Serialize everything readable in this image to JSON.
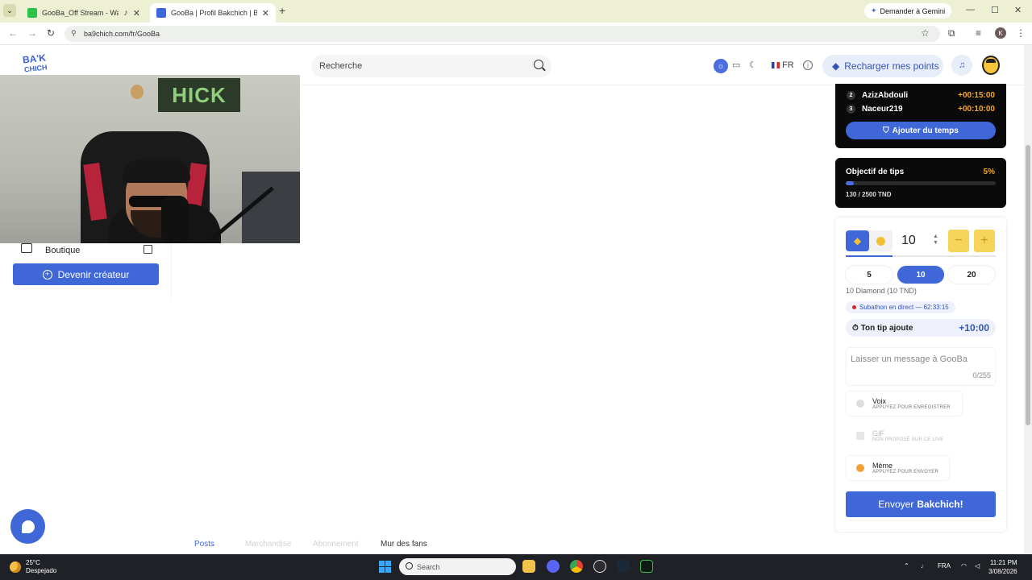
{
  "browser": {
    "tabs": [
      {
        "title": "GooBa_Off Stream - Watch",
        "active": false
      },
      {
        "title": "GooBa | Profil Bakchich | Bakch",
        "active": true
      }
    ],
    "gemini_label": "Demander à Gemini",
    "url": "ba9chich.com/fr/GooBa",
    "profile_initial": "K"
  },
  "header": {
    "logo_line1": "BA'K",
    "logo_line2": "CHICH",
    "search_placeholder": "Recherche",
    "language": "FR",
    "recharge_label": "Recharger mes points"
  },
  "sidebar": {
    "shop_label": "Boutique",
    "become_creator_label": "Devenir créateur"
  },
  "leaderboard": {
    "rows": [
      {
        "rank": "2",
        "name": "AzizAbdouli",
        "time": "+00:15:00"
      },
      {
        "rank": "3",
        "name": "Naceur219",
        "time": "+00:10:00"
      }
    ],
    "add_time_label": "Ajouter du temps"
  },
  "tip_goal": {
    "title": "Objectif de tips",
    "percent": "5%",
    "progress_fraction": 0.052,
    "amount": "130 / 2500 TND"
  },
  "tip_form": {
    "amount": "10",
    "presets": [
      "5",
      "10",
      "20"
    ],
    "selected_preset": "10",
    "description": "10 Diamond (10 TND)",
    "live_badge": "Subathon en direct — 62:33:15",
    "tip_adds_label": "Ton tip ajoute",
    "tip_adds_value": "+10:00",
    "message_placeholder": "Laisser un message à GooBa",
    "message_count": "0/255",
    "options": [
      {
        "title": "Voix",
        "subtitle": "APPUYEZ POUR ENREGISTRER",
        "enabled": true
      },
      {
        "title": "GIF",
        "subtitle": "NON PROPOSÉ SUR CE LIVE",
        "enabled": false
      },
      {
        "title": "Mème",
        "subtitle": "APPUYEZ POUR ENVOYER",
        "enabled": true
      }
    ],
    "send_label": "Envoyer",
    "send_brand": "Bakchich!"
  },
  "webcam": {
    "sign_text": "HICK"
  },
  "bottom_tabs": [
    {
      "label": "Posts",
      "state": "active"
    },
    {
      "label": "Marchandise",
      "state": "faded"
    },
    {
      "label": "Abonnement",
      "state": "faded"
    },
    {
      "label": "Mur des fans",
      "state": "normal"
    }
  ],
  "taskbar": {
    "temperature": "25°C",
    "weather": "Despejado",
    "search_label": "Search",
    "language": "FRA",
    "time": "11:21 PM",
    "date": "3/08/2026"
  },
  "colors": {
    "accent": "#3f67d8",
    "gold": "#f5a623",
    "dark_card": "#0a0a0a"
  }
}
